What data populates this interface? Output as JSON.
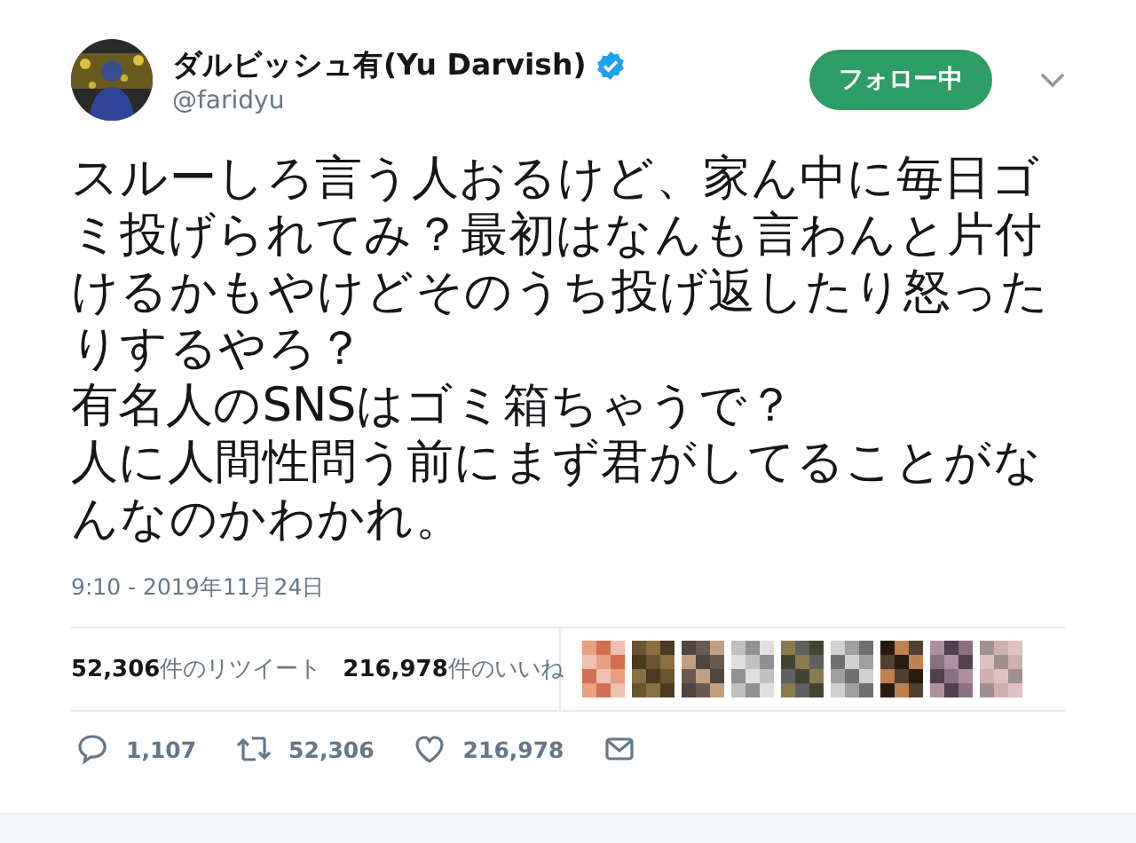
{
  "author": {
    "name": "ダルビッシュ有(Yu Darvish)",
    "verified": true,
    "handle": "@faridyu"
  },
  "follow_button": {
    "label": "フォロー中"
  },
  "tweet": {
    "paragraphs": [
      "スルーしろ言う人おるけど、家ん中に毎日ゴミ投げられてみ？最初はなんも言わんと片付けるかもやけどそのうち投げ返したり怒ったりするやろ？",
      "有名人のSNSはゴミ箱ちゃうで？",
      "人に人間性問う前にまず君がしてることがなんなのかわかれ。"
    ]
  },
  "timestamp": "9:10 - 2019年11月24日",
  "stats": [
    {
      "text": "**52,306**件のリツイート"
    },
    {
      "text": "**216,978**件のいいね"
    }
  ],
  "actions": [
    {
      "kind": "reply",
      "count": "1,107"
    },
    {
      "kind": "retweet",
      "count": "52,306"
    },
    {
      "kind": "like",
      "count": "216,978"
    },
    {
      "kind": "message"
    }
  ]
}
